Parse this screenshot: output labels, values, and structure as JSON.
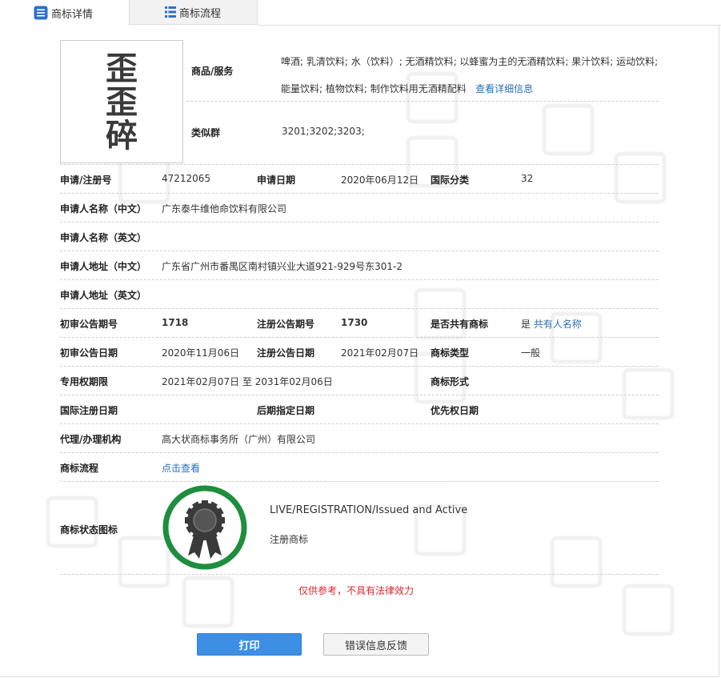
{
  "tabs": [
    {
      "label": "商标详情",
      "active": true
    },
    {
      "label": "商标流程",
      "active": false
    }
  ],
  "trademark": {
    "image_text": [
      "歪",
      "歪",
      "碎"
    ]
  },
  "goods": {
    "label": "商品/服务",
    "text": "啤酒; 乳清饮料; 水（饮料）; 无酒精饮料; 以蜂蜜为主的无酒精饮料; 果汁饮料; 运动饮料; 能量饮料; 植物饮料; 制作饮料用无酒精配料",
    "detail_link": "查看详细信息"
  },
  "similar_group": {
    "label": "类似群",
    "value": "3201;3202;3203;"
  },
  "fields": {
    "reg_no": {
      "label": "申请/注册号",
      "value": "47212065"
    },
    "app_date": {
      "label": "申请日期",
      "value": "2020年06月12日"
    },
    "intl_class": {
      "label": "国际分类",
      "value": "32"
    },
    "applicant_cn": {
      "label": "申请人名称（中文）",
      "value": "广东泰牛维他命饮料有限公司"
    },
    "applicant_en": {
      "label": "申请人名称（英文）",
      "value": ""
    },
    "address_cn": {
      "label": "申请人地址（中文）",
      "value": "广东省广州市番禺区南村镇兴业大道921-929号东301-2"
    },
    "address_en": {
      "label": "申请人地址（英文）",
      "value": ""
    },
    "prelim_issue": {
      "label": "初审公告期号",
      "value": "1718"
    },
    "reg_issue": {
      "label": "注册公告期号",
      "value": "1730"
    },
    "shared": {
      "label": "是否共有商标",
      "value": "是",
      "link": "共有人名称"
    },
    "prelim_date": {
      "label": "初审公告日期",
      "value": "2020年11月06日"
    },
    "reg_date": {
      "label": "注册公告日期",
      "value": "2021年02月07日"
    },
    "tm_type": {
      "label": "商标类型",
      "value": "一般"
    },
    "exclusive_period": {
      "label": "专用权期限",
      "value": "2021年02月07日 至 2031年02月06日"
    },
    "tm_form": {
      "label": "商标形式",
      "value": ""
    },
    "intl_reg_date": {
      "label": "国际注册日期",
      "value": ""
    },
    "later_designation": {
      "label": "后期指定日期",
      "value": ""
    },
    "priority_date": {
      "label": "优先权日期",
      "value": ""
    },
    "agent": {
      "label": "代理/办理机构",
      "value": "高大状商标事务所（广州）有限公司"
    },
    "process": {
      "label": "商标流程",
      "link": "点击查看"
    },
    "status_icon": {
      "label": "商标状态图标"
    }
  },
  "status": {
    "en": "LIVE/REGISTRATION/Issued and Active",
    "cn": "注册商标",
    "color": "#1e8e3e"
  },
  "disclaimer": "仅供参考，不具有法律效力",
  "buttons": {
    "print": "打印",
    "feedback": "错误信息反馈"
  },
  "colors": {
    "link": "#2a6fb5",
    "primary": "#3d8fe6",
    "warning": "#d9262e"
  }
}
